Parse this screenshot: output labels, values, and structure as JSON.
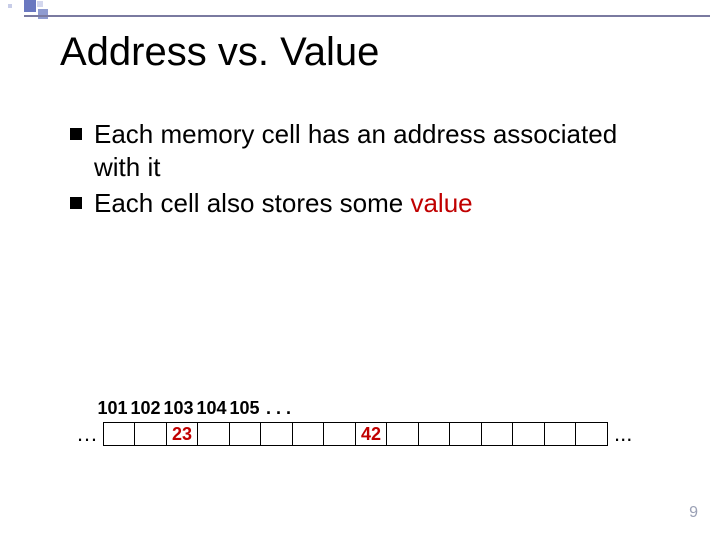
{
  "title": "Address vs. Value",
  "bullets": {
    "b1": "Each memory cell has an address associated with it",
    "b2_pre": "Each cell also stores some ",
    "b2_val": "value"
  },
  "memory": {
    "ellipsis_left": "…",
    "ellipsis_right": "...",
    "addresses": {
      "a1": "101",
      "a2": "102",
      "a3": "103",
      "a4": "104",
      "a5": "105",
      "dots": ". . ."
    },
    "cells": {
      "c1": "",
      "c2": "",
      "c3": "23",
      "c4": "",
      "c5": "",
      "c6": "",
      "c7": "",
      "c8": "",
      "c9": "42",
      "c10": "",
      "c11": "",
      "c12": "",
      "c13": "",
      "c14": "",
      "c15": "",
      "c16": ""
    }
  },
  "page_number": "9"
}
